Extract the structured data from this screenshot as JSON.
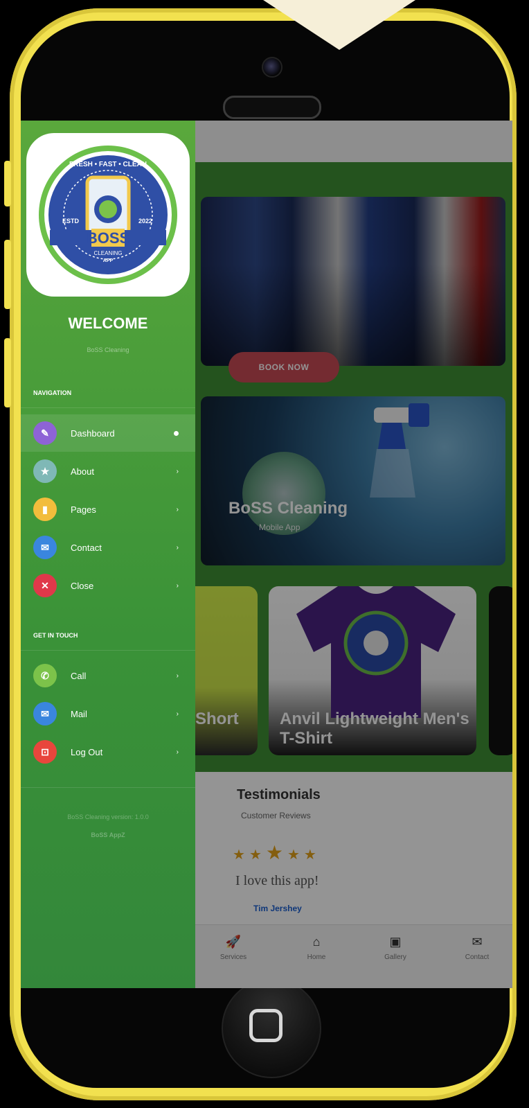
{
  "drawer": {
    "welcome": "WELCOME",
    "subtitle": "BoSS Cleaning",
    "logo": {
      "ring_top": "FRESH • FAST • CLEAN",
      "estd": "ESTD",
      "year": "2022",
      "brand": "BOSS",
      "line1": "CLEANING",
      "line2": "APP"
    },
    "nav_heading": "NAVIGATION",
    "nav_items": [
      {
        "label": "Dashboard",
        "icon": "wrench-icon",
        "color": "#8e63d6"
      },
      {
        "label": "About",
        "icon": "star-icon",
        "color": "#7fb8b6"
      },
      {
        "label": "Pages",
        "icon": "file-icon",
        "color": "#f2bd3c"
      },
      {
        "label": "Contact",
        "icon": "envelope-icon",
        "color": "#3a86de"
      },
      {
        "label": "Close",
        "icon": "close-icon",
        "color": "#e0384a"
      }
    ],
    "touch_heading": "GET IN TOUCH",
    "touch_items": [
      {
        "label": "Call",
        "icon": "phone-icon",
        "color": "#7cc34a"
      },
      {
        "label": "Mail",
        "icon": "envelope-icon",
        "color": "#3a86de"
      },
      {
        "label": "Log Out",
        "icon": "unlock-icon",
        "color": "#e8463c"
      }
    ],
    "version": "BoSS Cleaning version: 1.0.0",
    "appz": "BoSS AppZ"
  },
  "hero": {
    "button": "BOOK NOW"
  },
  "promo": {
    "title": "BoSS Cleaning",
    "subtitle": "Mobile App"
  },
  "products": [
    {
      "title": "Short"
    },
    {
      "title": "Anvil Lightweight Men's T-Shirt"
    }
  ],
  "testimonials": {
    "title": "Testimonials",
    "subtitle": "Customer Reviews",
    "rating": 5,
    "quote": "I love this app!",
    "author": "Tim Jershey"
  },
  "bottom_nav": [
    {
      "label": "Services",
      "icon": "rocket-icon"
    },
    {
      "label": "Home",
      "icon": "home-icon"
    },
    {
      "label": "Gallery",
      "icon": "image-icon"
    },
    {
      "label": "Contact",
      "icon": "envelope-icon"
    }
  ],
  "colors": {
    "frame": "#f2e14f",
    "drawer": "#3a9238",
    "accent_button": "#c94a55"
  }
}
